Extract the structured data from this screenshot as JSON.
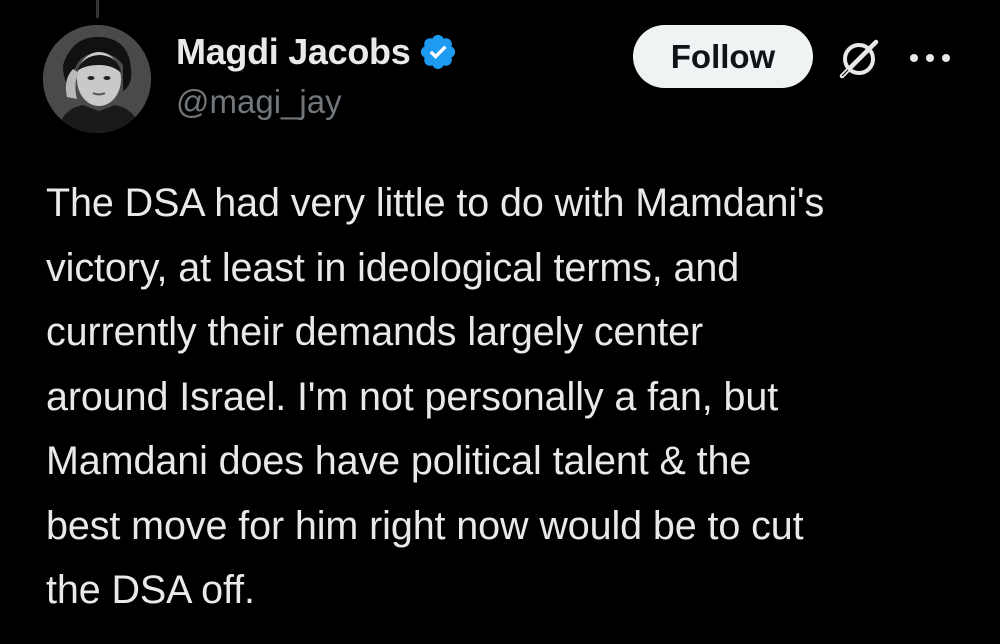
{
  "author": {
    "display_name": "Magdi Jacobs",
    "handle": "@magi_jay",
    "verified": true,
    "avatar_icon": "profile-photo"
  },
  "actions": {
    "follow_label": "Follow",
    "grok_icon": "grok-icon",
    "more_icon": "more-options-icon"
  },
  "tweet": {
    "text": "The DSA had very little to do with Mamdani's\nvictory, at least in ideological terms, and\ncurrently their demands largely center\naround Israel. I'm not personally a fan, but\nMamdani does have political talent & the\nbest move for him right now would be to cut\nthe DSA off."
  },
  "colors": {
    "background": "#000000",
    "text_primary": "#e7e9ea",
    "text_secondary": "#71767b",
    "verified_blue": "#1d9bf0",
    "follow_bg": "#eff3f4",
    "follow_text": "#0f1419"
  }
}
